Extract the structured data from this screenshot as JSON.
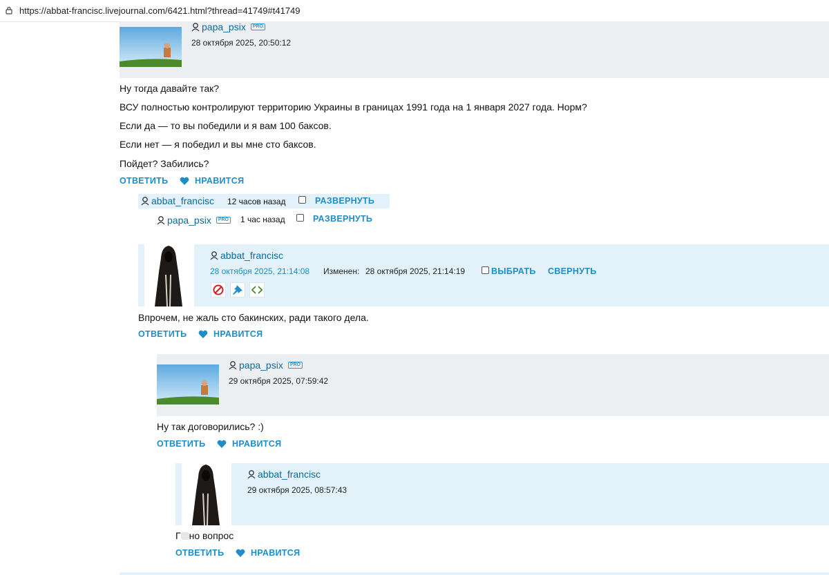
{
  "browser": {
    "url": "https://abbat-francisc.livejournal.com/6421.html?thread=41749#t41749"
  },
  "actions": {
    "reply": "ОТВЕТИТЬ",
    "like": "НРАВИТСЯ",
    "expand": "РАЗВЕРНУТЬ",
    "collapse": "СВЕРНУТЬ",
    "select": "ВЫБРАТЬ",
    "edited_label": "Изменен:"
  },
  "badge": {
    "pro": "PRO"
  },
  "comment1": {
    "user": "papa_psix",
    "date": "28 октября 2025, 20:50:12",
    "lines": [
      "Ну тогда давайте так?",
      "ВСУ полностью контролируют территорию Украины в границах 1991 года на 1 января 2027 года. Норм?",
      "Если да — то вы победили и я вам 100 баксов.",
      "Если нет — я победил и вы мне сто баксов.",
      "Пойдет? Забились?"
    ]
  },
  "collapsed1": {
    "user": "abbat_francisc",
    "time": "12 часов назад"
  },
  "collapsed2": {
    "user": "papa_psix",
    "time": "1 час назад"
  },
  "comment2": {
    "user": "abbat_francisc",
    "date": "28 октября 2025, 21:14:08",
    "edited_date": "28 октября 2025, 21:14:19",
    "text": "Впрочем, не жаль сто бакинских, ради такого дела."
  },
  "comment3": {
    "user": "papa_psix",
    "date": "29 октября 2025, 07:59:42",
    "text": "Ну так договорились? :)"
  },
  "comment4": {
    "user": "abbat_francisc",
    "date": "29 октября 2025, 08:57:43",
    "text_start": "Г",
    "text_end": "но вопрос"
  },
  "colors": {
    "link": "#1e8dc8",
    "header_grey": "#ebeff2",
    "header_blue": "#e3f2fa"
  }
}
